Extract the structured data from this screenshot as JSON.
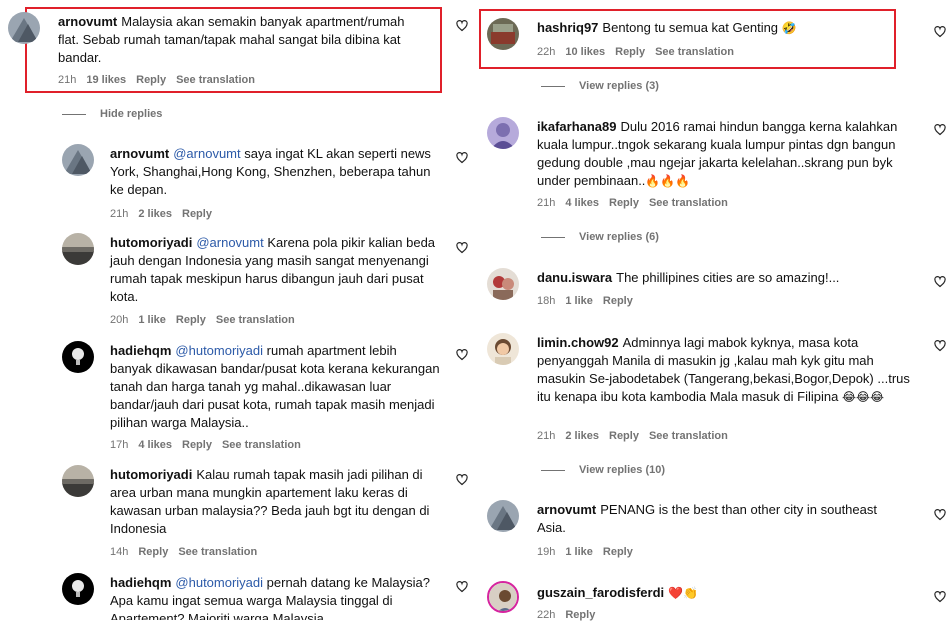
{
  "left": {
    "top": {
      "username": "arnovumt",
      "text": "Malaysia akan semakin banyak apartment/rumah flat. Sebab rumah taman/tapak mahal sangat bila dibina kat bandar.",
      "time": "21h",
      "likes": "19 likes",
      "reply": "Reply",
      "translate": "See translation"
    },
    "hide_replies": "Hide replies",
    "replies": [
      {
        "username": "arnovumt",
        "mention": "@arnovumt",
        "text": "saya ingat KL akan seperti news York, Shanghai,Hong Kong, Shenzhen, beberapa tahun ke depan.",
        "time": "21h",
        "likes": "2 likes",
        "reply": "Reply",
        "translate": ""
      },
      {
        "username": "hutomoriyadi",
        "mention": "@arnovumt",
        "text": "Karena pola pikir kalian beda jauh dengan Indonesia yang masih sangat menyenangi rumah tapak meskipun harus dibangun jauh dari pusat kota.",
        "time": "20h",
        "likes": "1 like",
        "reply": "Reply",
        "translate": "See translation"
      },
      {
        "username": "hadiehqm",
        "mention": "@hutomoriyadi",
        "text": "rumah apartment lebih banyak dikawasan bandar/pusat kota kerana kekurangan tanah dan harga tanah yg mahal..dikawasan luar bandar/jauh dari pusat kota, rumah tapak masih menjadi pilihan warga Malaysia..",
        "time": "17h",
        "likes": "4 likes",
        "reply": "Reply",
        "translate": "See translation"
      },
      {
        "username": "hutomoriyadi",
        "mention": "",
        "text": "Kalau rumah tapak masih jadi pilihan di area urban mana mungkin apartement laku keras di kawasan urban malaysia?? Beda jauh bgt itu dengan di Indonesia",
        "time": "14h",
        "likes": "",
        "reply": "Reply",
        "translate": "See translation"
      },
      {
        "username": "hadiehqm",
        "mention": "@hutomoriyadi",
        "text": "pernah datang ke Malaysia? Apa kamu ingat semua warga Malaysia tinggal di Apartement? Majoriti warga Malaysia",
        "time": "",
        "likes": "",
        "reply": "",
        "translate": ""
      }
    ]
  },
  "right": {
    "comments": [
      {
        "username": "hashriq97",
        "text": "Bentong tu semua kat Genting",
        "emoji": "🤣",
        "time": "22h",
        "likes": "10 likes",
        "reply": "Reply",
        "translate": "See translation",
        "view_replies": "View replies (3)"
      },
      {
        "username": "ikafarhana89",
        "text": "Dulu 2016 ramai hindun bangga kerna kalahkan kuala lumpur..tngok sekarang kuala lumpur pintas dgn bangun gedung double ,mau ngejar jakarta kelelahan..skrang pun byk under pembinaan..",
        "emoji": "🔥🔥🔥",
        "time": "21h",
        "likes": "4 likes",
        "reply": "Reply",
        "translate": "See translation",
        "view_replies": "View replies (6)"
      },
      {
        "username": "danu.iswara",
        "text": "The phillipines cities are so amazing!...",
        "emoji": "",
        "time": "18h",
        "likes": "1 like",
        "reply": "Reply",
        "translate": "",
        "view_replies": ""
      },
      {
        "username": "limin.chow92",
        "text": "Adminnya lagi mabok kyknya, masa kota penyanggah Manila di masukin jg ,kalau mah kyk gitu mah masukin Se-jabodetabek (Tangerang,bekasi,Bogor,Depok) ...trus itu kenapa ibu kota kambodia Mala masuk di Filipina",
        "emoji": "😂😂😂",
        "time": "21h",
        "likes": "2 likes",
        "reply": "Reply",
        "translate": "See translation",
        "view_replies": "View replies (10)"
      },
      {
        "username": "arnovumt",
        "text": "PENANG is the best than other city in southeast Asia.",
        "emoji": "",
        "time": "19h",
        "likes": "1 like",
        "reply": "Reply",
        "translate": "",
        "view_replies": ""
      },
      {
        "username": "guszain_farodisferdi",
        "text": "",
        "emoji": "❤️👏",
        "time": "22h",
        "likes": "",
        "reply": "Reply",
        "translate": "",
        "view_replies": ""
      }
    ]
  },
  "colors": {
    "highlight": "#e0202a",
    "mention": "#2c5aa8",
    "meta": "#737373"
  }
}
